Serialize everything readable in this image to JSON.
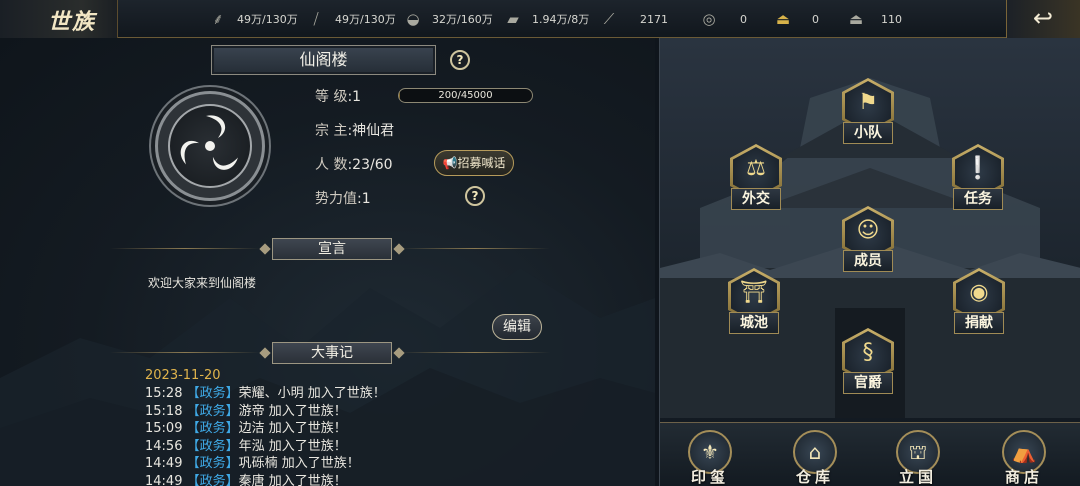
{
  "header": {
    "logo": "世族",
    "resources": [
      {
        "icon": "wheat-icon",
        "value": "49万/130万"
      },
      {
        "icon": "wood-icon",
        "value": "49万/130万"
      },
      {
        "icon": "stone-icon",
        "value": "32万/160万"
      },
      {
        "icon": "iron-icon",
        "value": "1.94万/8万"
      },
      {
        "icon": "token-icon",
        "value": "2171"
      },
      {
        "icon": "coin-icon",
        "value": "0"
      },
      {
        "icon": "gold-ingot-icon",
        "value": "0"
      },
      {
        "icon": "silver-ingot-icon",
        "value": "110"
      }
    ]
  },
  "clan": {
    "name": "仙阁楼",
    "level_label": "等    级",
    "level": ":1",
    "exp_text": "200/45000",
    "exp_progress": 0.0044,
    "leader_label": "宗    主",
    "leader": ":神仙君",
    "members_label": "人    数",
    "members": ":23/60",
    "recruit_label": "招募喊话",
    "power_label": "势力值",
    "power": ":1",
    "help_glyph": "?"
  },
  "manifesto": {
    "title": "宣言",
    "text": "欢迎大家来到仙阁楼",
    "edit_label": "编辑"
  },
  "events": {
    "title": "大事记",
    "date": "2023-11-20",
    "items": [
      {
        "time": "15:28",
        "tag": "【政务】",
        "text": "荣耀、小明 加入了世族！"
      },
      {
        "time": "15:18",
        "tag": "【政务】",
        "text": "游帝 加入了世族！"
      },
      {
        "time": "15:09",
        "tag": "【政务】",
        "text": "边洁 加入了世族！"
      },
      {
        "time": "14:56",
        "tag": "【政务】",
        "text": "年泓 加入了世族！"
      },
      {
        "time": "14:49",
        "tag": "【政务】",
        "text": "巩砾楠 加入了世族！"
      },
      {
        "time": "14:49",
        "tag": "【政务】",
        "text": "秦唐 加入了世族！"
      }
    ]
  },
  "functions": {
    "squad": "小队",
    "diplomacy": "外交",
    "tasks": "任务",
    "members": "成员",
    "city": "城池",
    "donate": "捐献",
    "rank": "官爵"
  },
  "bottom_nav": {
    "seal": "印玺",
    "warehouse": "仓库",
    "found_state": "立国",
    "shop": "商店"
  }
}
